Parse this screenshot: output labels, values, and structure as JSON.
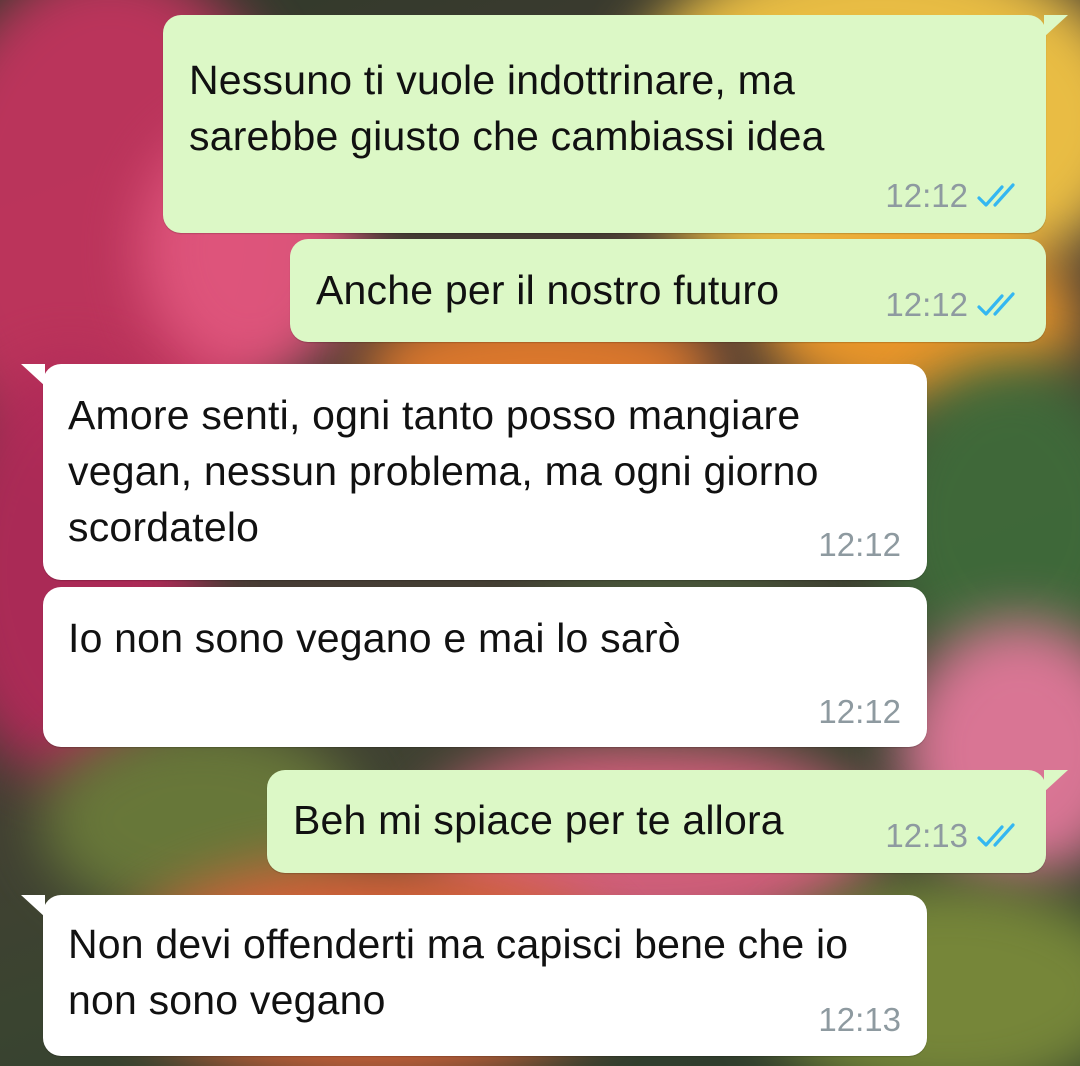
{
  "messages": [
    {
      "direction": "out",
      "text": "Nessuno ti vuole indottrinare, ma sarebbe giusto che cambiassi idea",
      "time": "12:12",
      "read": true
    },
    {
      "direction": "out",
      "text": "Anche per il nostro futuro",
      "time": "12:12",
      "read": true
    },
    {
      "direction": "in",
      "text": "Amore senti, ogni tanto posso mangiare vegan, nessun problema, ma ogni giorno scordatelo",
      "time": "12:12"
    },
    {
      "direction": "in",
      "text": "Io non sono vegano e mai lo sarò",
      "time": "12:12"
    },
    {
      "direction": "out",
      "text": "Beh mi spiace per te allora",
      "time": "12:13",
      "read": true
    },
    {
      "direction": "in",
      "text": "Non devi offenderti ma capisci bene che io non sono vegano",
      "time": "12:13"
    }
  ],
  "colors": {
    "outgoing_bubble": "#dcf8c6",
    "incoming_bubble": "#ffffff",
    "read_ticks": "#34b7f1",
    "timestamp": "#8e9aa0"
  },
  "icons": {
    "read_receipt": "double-check-icon"
  }
}
